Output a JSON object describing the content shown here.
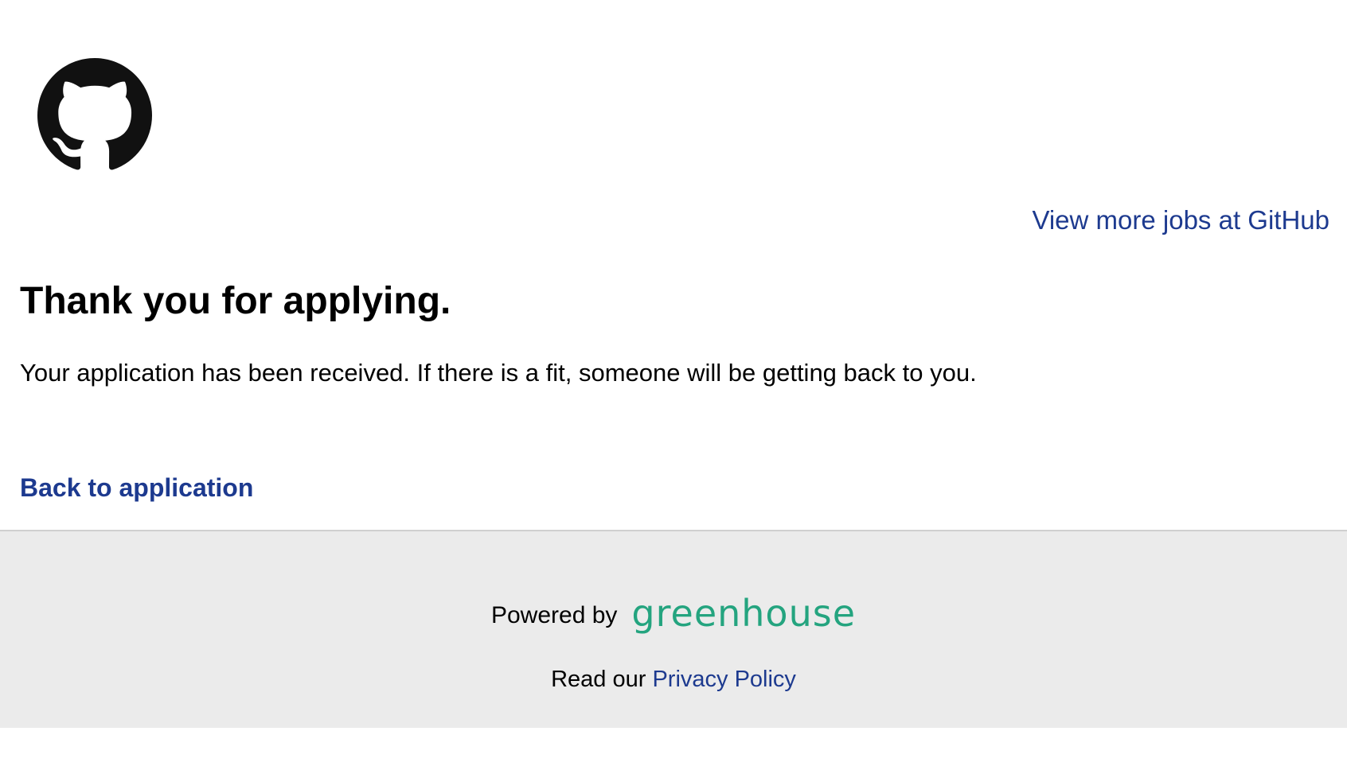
{
  "header": {
    "logo_icon": "github-octocat-icon",
    "view_more_jobs": "View more jobs at GitHub"
  },
  "main": {
    "title": "Thank you for applying.",
    "message": "Your application has been received. If there is a fit, someone will be getting back to you.",
    "back_link": "Back to application"
  },
  "footer": {
    "powered_by": "Powered by",
    "brand": "greenhouse",
    "privacy_prefix": "Read our",
    "privacy_link": "Privacy Policy"
  },
  "colors": {
    "link": "#1d3a8f",
    "brand": "#24a47f",
    "footer_bg": "#ebebeb"
  }
}
